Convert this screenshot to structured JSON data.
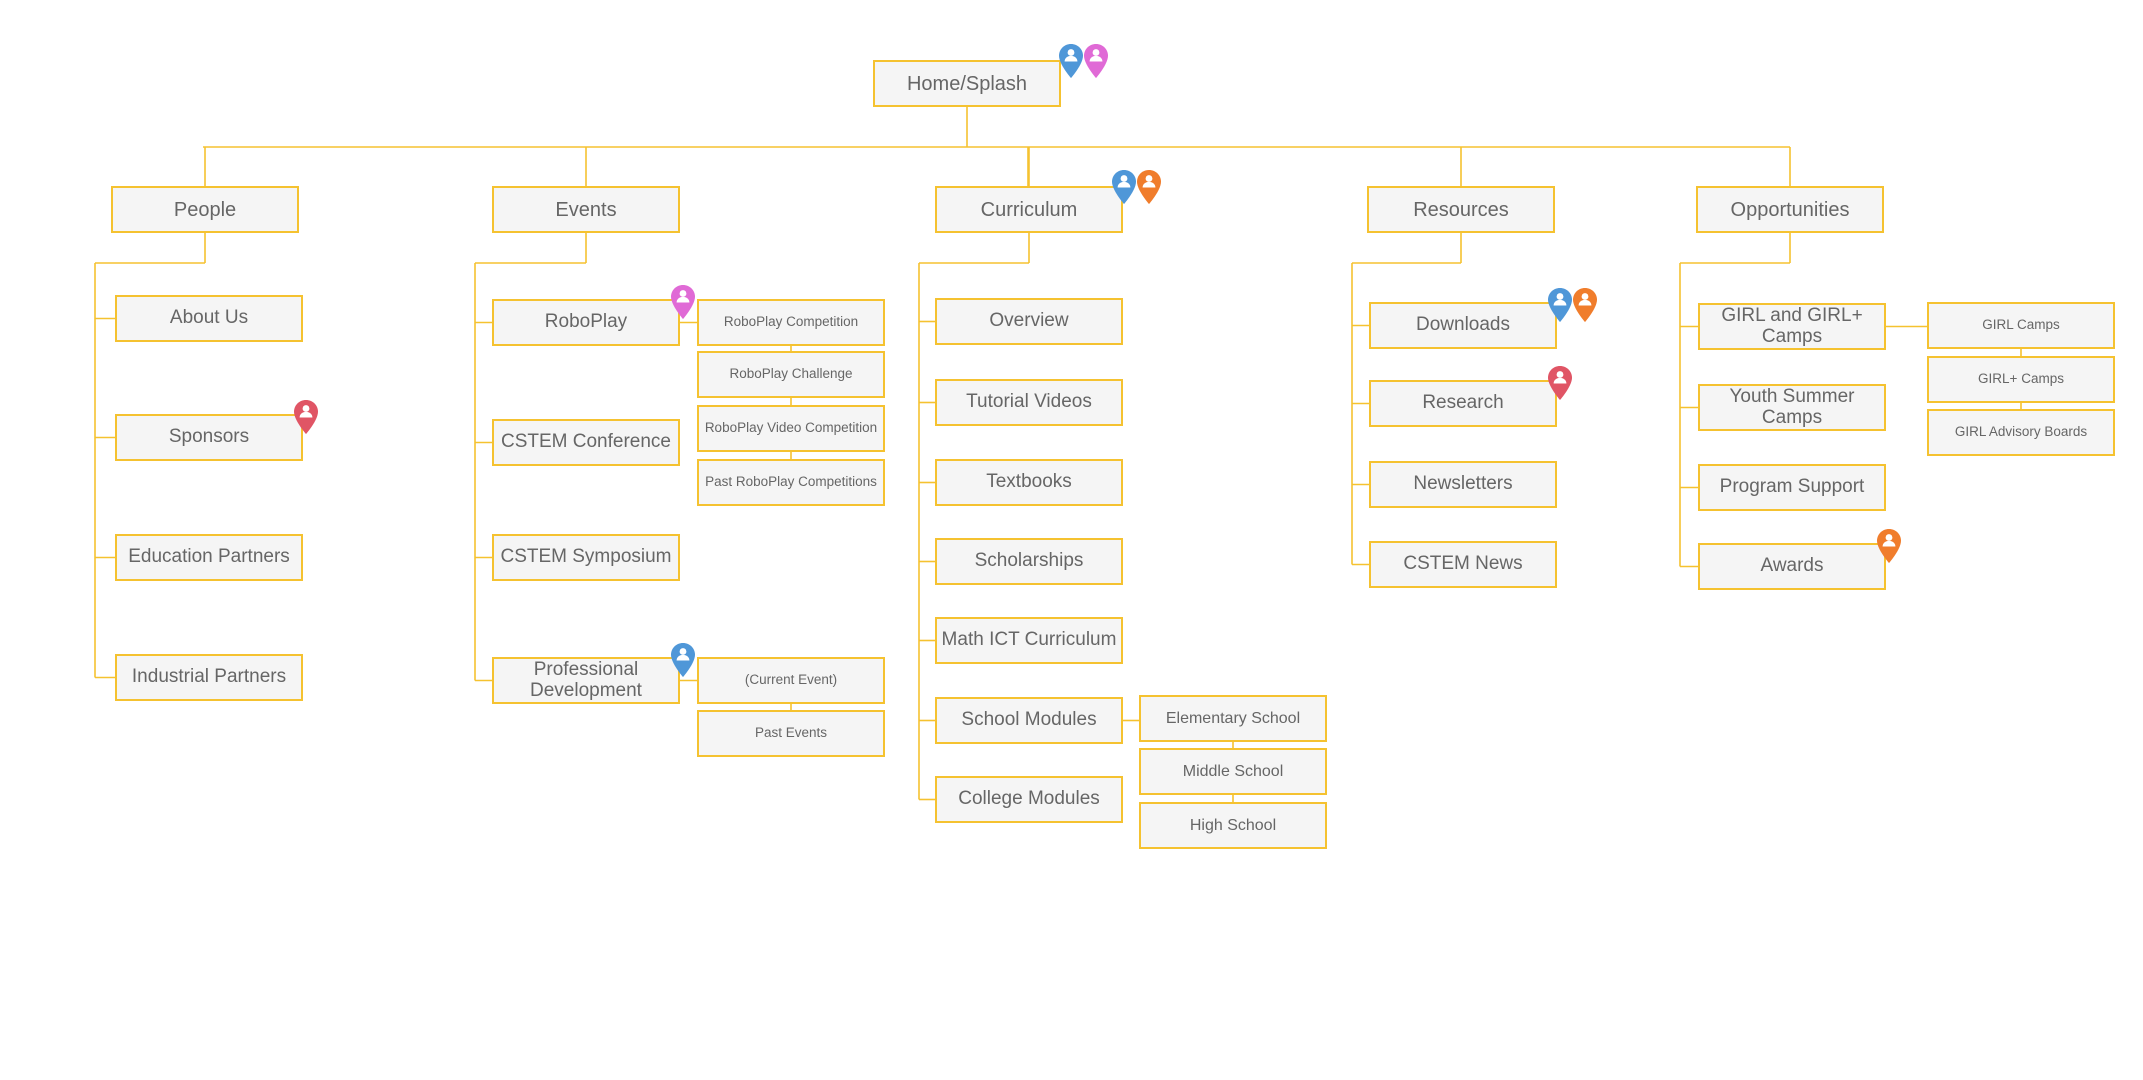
{
  "colors": {
    "connector": "#f5c230",
    "node_border": "#f5c230",
    "node_fill": "#f5f5f5",
    "text": "#666666",
    "persona_blue": "#4f97d8",
    "persona_pink": "#e06ad6",
    "persona_orange": "#f07d2c",
    "persona_red": "#e05565"
  },
  "sitemap": {
    "root": {
      "label": "Home/Splash",
      "personas": [
        "blue",
        "pink"
      ]
    },
    "sections": [
      {
        "label": "People",
        "personas": [],
        "children": [
          {
            "label": "About Us",
            "personas": [],
            "children": []
          },
          {
            "label": "Sponsors",
            "personas": [
              "red"
            ],
            "children": []
          },
          {
            "label": "Education Partners",
            "personas": [],
            "children": []
          },
          {
            "label": "Industrial Partners",
            "personas": [],
            "children": []
          }
        ]
      },
      {
        "label": "Events",
        "personas": [],
        "children": [
          {
            "label": "RoboPlay",
            "personas": [
              "pink"
            ],
            "children": [
              {
                "label": "RoboPlay Competition"
              },
              {
                "label": "RoboPlay Challenge"
              },
              {
                "label": "RoboPlay Video Competition"
              },
              {
                "label": "Past RoboPlay Competitions"
              }
            ]
          },
          {
            "label": "CSTEM Conference",
            "personas": [],
            "children": []
          },
          {
            "label": "CSTEM Symposium",
            "personas": [],
            "children": []
          },
          {
            "label": "Professional Development",
            "personas": [
              "blue"
            ],
            "children": [
              {
                "label": "(Current Event)"
              },
              {
                "label": "Past Events"
              }
            ]
          }
        ]
      },
      {
        "label": "Curriculum",
        "personas": [
          "blue",
          "orange"
        ],
        "children": [
          {
            "label": "Overview",
            "personas": [],
            "children": []
          },
          {
            "label": "Tutorial Videos",
            "personas": [],
            "children": []
          },
          {
            "label": "Textbooks",
            "personas": [],
            "children": []
          },
          {
            "label": "Scholarships",
            "personas": [],
            "children": []
          },
          {
            "label": "Math ICT Curriculum",
            "personas": [],
            "children": []
          },
          {
            "label": "School Modules",
            "personas": [],
            "children": [
              {
                "label": "Elementary School"
              },
              {
                "label": "Middle School"
              },
              {
                "label": "High School"
              }
            ]
          },
          {
            "label": "College Modules",
            "personas": [],
            "children": []
          }
        ]
      },
      {
        "label": "Resources",
        "personas": [],
        "children": [
          {
            "label": "Downloads",
            "personas": [
              "blue",
              "orange"
            ],
            "children": []
          },
          {
            "label": "Research",
            "personas": [
              "red"
            ],
            "children": []
          },
          {
            "label": "Newsletters",
            "personas": [],
            "children": []
          },
          {
            "label": "CSTEM News",
            "personas": [],
            "children": []
          }
        ]
      },
      {
        "label": "Opportunities",
        "personas": [],
        "children": [
          {
            "label": "GIRL and GIRL+ Camps",
            "personas": [],
            "children": [
              {
                "label": "GIRL Camps"
              },
              {
                "label": "GIRL+ Camps"
              },
              {
                "label": "GIRL Advisory Boards"
              }
            ]
          },
          {
            "label": "Youth Summer Camps",
            "personas": [],
            "children": []
          },
          {
            "label": "Program Support",
            "personas": [],
            "children": []
          },
          {
            "label": "Awards",
            "personas": [
              "orange"
            ],
            "children": []
          }
        ]
      }
    ]
  }
}
